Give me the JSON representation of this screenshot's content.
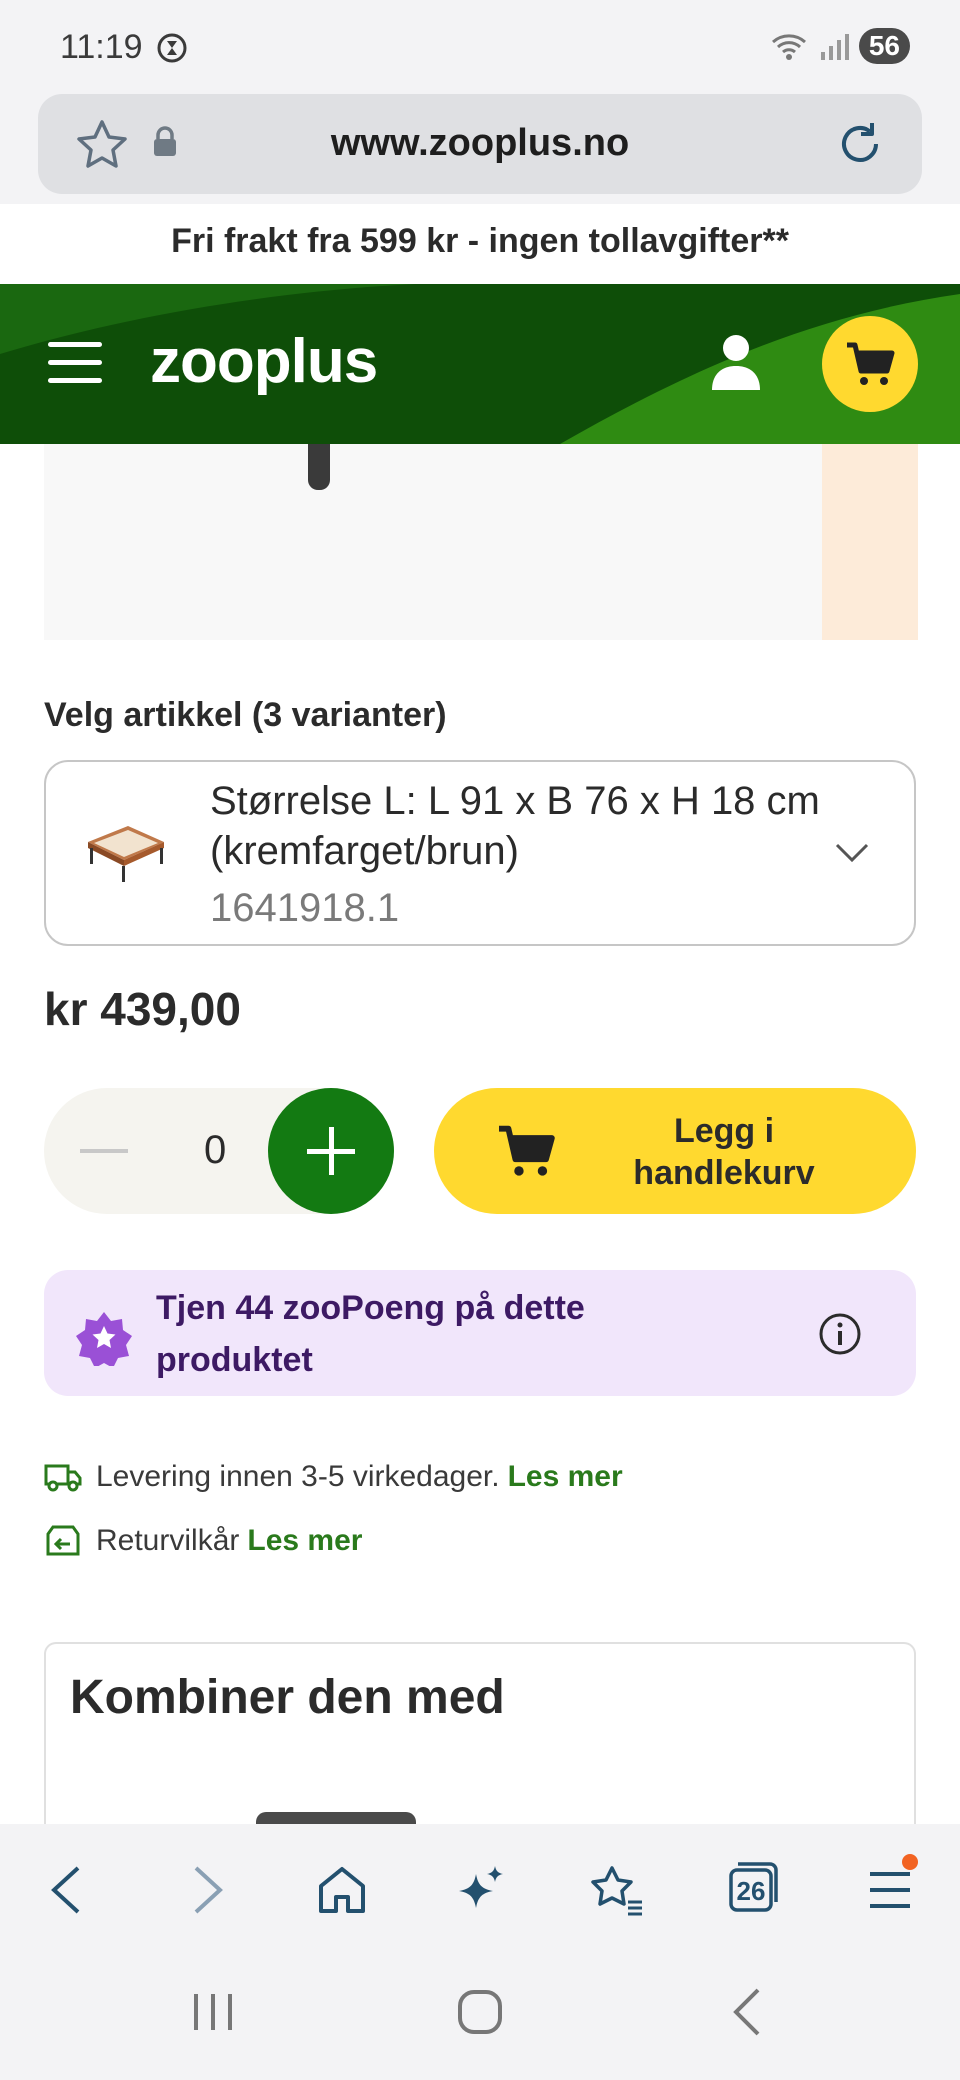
{
  "status_bar": {
    "time": "11:19",
    "battery": "56"
  },
  "browser": {
    "url": "www.zooplus.no",
    "tab_count": "26"
  },
  "promo_banner": "Fri frakt fra 599 kr - ingen tollavgifter**",
  "header": {
    "logo": "zooplus"
  },
  "variant": {
    "label": "Velg artikkel (3 varianter)",
    "selected_name": "Størrelse L: L 91 x B 76 x H 18 cm (kremfarget/brun)",
    "sku": "1641918.1"
  },
  "price": "kr 439,00",
  "quantity": {
    "value": "0"
  },
  "add_to_cart_label": "Legg i handlekurv",
  "points_text": "Tjen 44 zooPoeng på dette produktet",
  "delivery": {
    "text": "Levering innen 3-5 virkedager.",
    "link": "Les mer"
  },
  "returns": {
    "text": "Returvilkår",
    "link": "Les mer"
  },
  "combine_title": "Kombiner den med",
  "colors": {
    "brand_green": "#0e4e08",
    "accent_yellow": "#ffd92f",
    "plus_green": "#137a12",
    "points_bg": "#f1e6fb",
    "link_green": "#2a7a1c"
  },
  "icons": [
    "star-icon",
    "lock-icon",
    "reload-icon",
    "hamburger-icon",
    "user-icon",
    "cart-icon",
    "chevron-down-icon",
    "points-star-icon",
    "info-icon",
    "truck-icon",
    "return-icon",
    "back-icon",
    "forward-icon",
    "home-icon",
    "sparkle-icon",
    "bookmarks-icon",
    "tabs-icon",
    "menu-icon"
  ]
}
